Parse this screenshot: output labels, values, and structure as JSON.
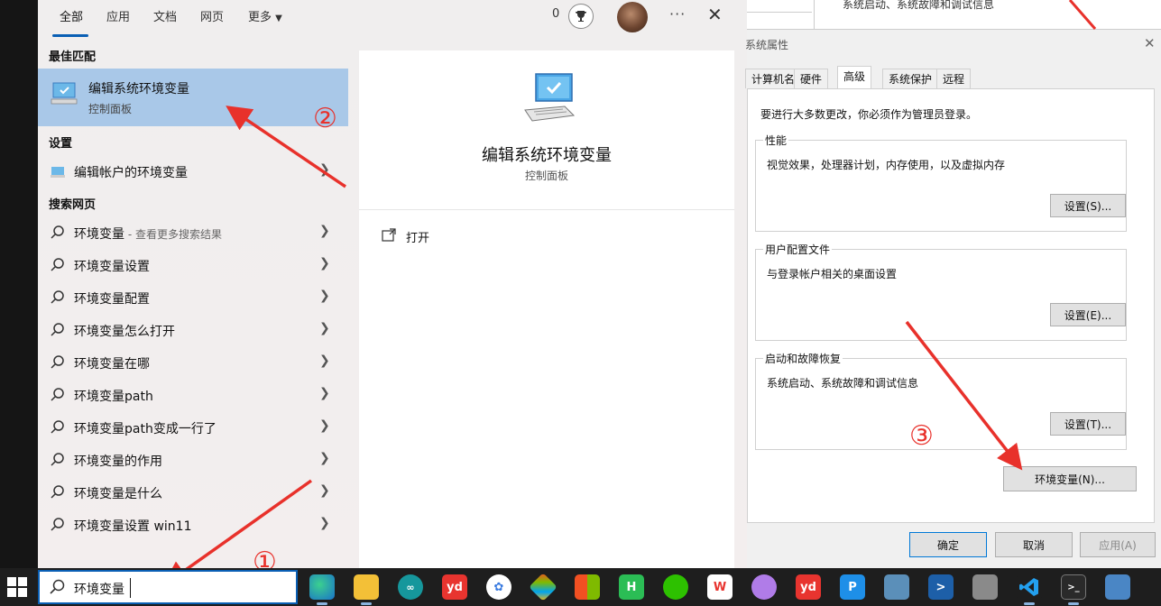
{
  "search": {
    "tabs": [
      "全部",
      "应用",
      "文档",
      "网页",
      "更多"
    ],
    "points": "0",
    "best_match_header": "最佳匹配",
    "best_match": {
      "title": "编辑系统环境变量",
      "subtitle": "控制面板"
    },
    "settings_header": "设置",
    "settings_item": "编辑帐户的环境变量",
    "web_header": "搜索网页",
    "web_first": {
      "text": "环境变量",
      "sub": " - 查看更多搜索结果"
    },
    "web_items": [
      "环境变量设置",
      "环境变量配置",
      "环境变量怎么打开",
      "环境变量在哪",
      "环境变量path",
      "环境变量path变成一行了",
      "环境变量的作用",
      "环境变量是什么",
      "环境变量设置 win11"
    ],
    "preview": {
      "title": "编辑系统环境变量",
      "subtitle": "控制面板",
      "open_label": "打开"
    }
  },
  "background_text": "系统启动、系统故障和调试信息",
  "system_properties": {
    "title": "系统属性",
    "tabs": [
      "计算机名",
      "硬件",
      "高级",
      "系统保护",
      "远程"
    ],
    "admin_note": "要进行大多数更改，你必须作为管理员登录。",
    "performance": {
      "label": "性能",
      "desc": "视觉效果，处理器计划，内存使用，以及虚拟内存",
      "button": "设置(S)..."
    },
    "user_profiles": {
      "label": "用户配置文件",
      "desc": "与登录帐户相关的桌面设置",
      "button": "设置(E)..."
    },
    "startup": {
      "label": "启动和故障恢复",
      "desc": "系统启动、系统故障和调试信息",
      "button": "设置(T)..."
    },
    "env_button": "环境变量(N)...",
    "ok": "确定",
    "cancel": "取消",
    "apply": "应用(A)"
  },
  "annotations": {
    "step1": "①",
    "step2": "②",
    "step3": "③"
  },
  "taskbar": {
    "search_text": "环境变量",
    "apps": [
      "edge-icon",
      "file-explorer-icon",
      "arduino-icon",
      "youdao-icon",
      "photos-icon",
      "git-icon",
      "windows-store-icon",
      "hbuilder-icon",
      "wechat-icon",
      "wps-icon",
      "cat-icon",
      "youdao-dict-icon",
      "pycharm-icon",
      "remote-icon",
      "powershell-icon",
      "printer-icon",
      "vscode-icon",
      "terminal-icon",
      "network-icon"
    ],
    "app_labels": {
      "youdao": "yd",
      "hbuilder": "H",
      "pycharm": "P"
    }
  },
  "colors": {
    "accent": "#0a5fb4",
    "selected": "#a9c8e8",
    "annotation": "#e8312b"
  }
}
